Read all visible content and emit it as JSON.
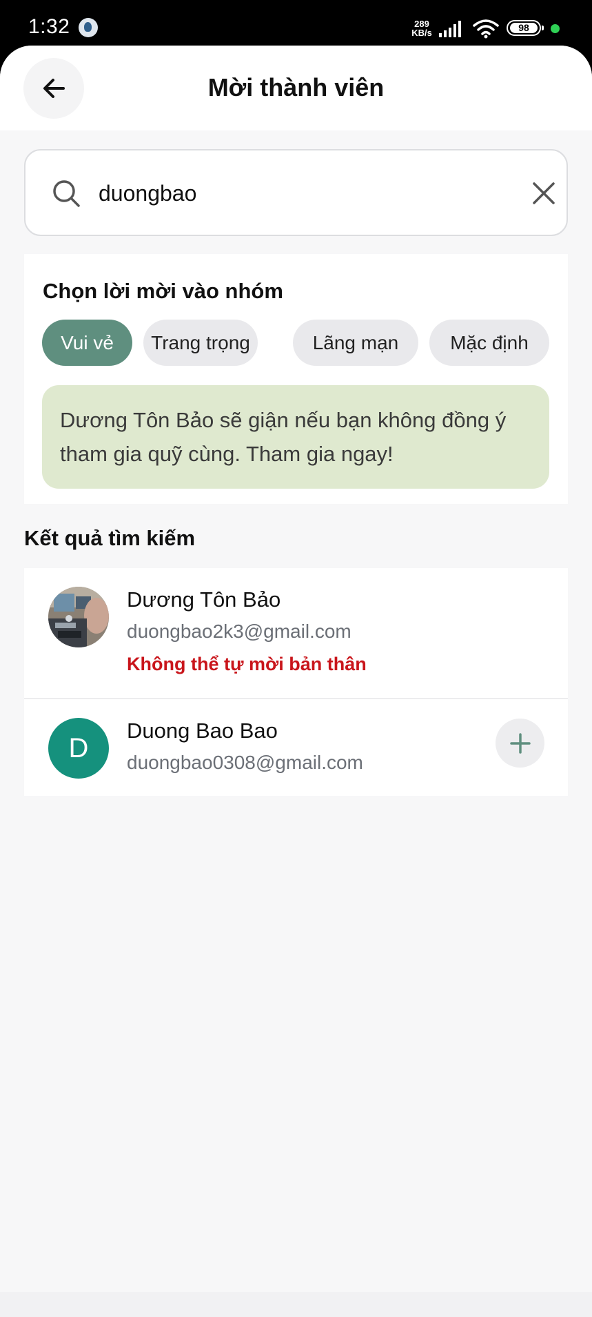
{
  "status_bar": {
    "time": "1:32",
    "net_speed_value": "289",
    "net_speed_unit": "KB/s",
    "battery": "98",
    "icons": [
      "app-notification-icon",
      "signal-icon",
      "wifi-icon",
      "battery-icon"
    ]
  },
  "header": {
    "title": "Mời thành viên",
    "back_icon": "arrow-left-icon"
  },
  "search": {
    "value": "duongbao",
    "placeholder": "",
    "icon": "search-icon",
    "clear_icon": "close-icon"
  },
  "invite": {
    "heading": "Chọn lời mời vào nhóm",
    "styles": [
      {
        "label": "Vui vẻ",
        "selected": true
      },
      {
        "label": "Trang trọng",
        "selected": false
      },
      {
        "label": "Lãng mạn",
        "selected": false
      },
      {
        "label": "Mặc định",
        "selected": false
      }
    ],
    "message": "Dương Tôn Bảo sẽ giận nếu bạn không đồng ý tham gia quỹ cùng. Tham gia ngay!"
  },
  "results": {
    "heading": "Kết quả tìm kiếm",
    "items": [
      {
        "name": "Dương Tôn Bảo",
        "email": "duongbao2k3@gmail.com",
        "status": "Không thể tự mời bản thân",
        "avatar": "photo"
      },
      {
        "name": "Duong Bao Bao",
        "email": "duongbao0308@gmail.com",
        "avatar_letter": "D",
        "action_icon": "plus-icon"
      }
    ]
  },
  "colors": {
    "accent": "#5f8f7f",
    "avatar_bg": "#15917d",
    "message_bg": "#dfe9cf",
    "error": "#c9151b"
  }
}
